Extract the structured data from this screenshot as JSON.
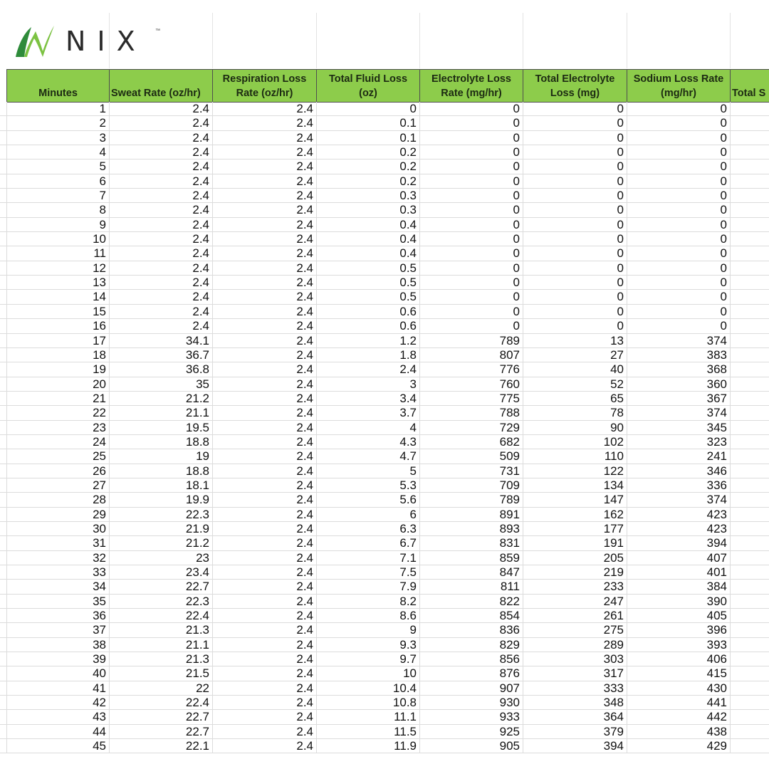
{
  "logo": {
    "text": "NIX",
    "tm": "™"
  },
  "headers": [
    "Minutes",
    "Sweat Rate (oz/hr)",
    "Respiration Loss\nRate (oz/hr)",
    "Total Fluid Loss\n(oz)",
    "Electrolyte Loss\nRate (mg/hr)",
    "Total Electrolyte\nLoss (mg)",
    "Sodium Loss Rate\n(mg/hr)",
    "Total S"
  ],
  "rows": [
    [
      "1",
      "2.4",
      "2.4",
      "0",
      "0",
      "0",
      "0"
    ],
    [
      "2",
      "2.4",
      "2.4",
      "0.1",
      "0",
      "0",
      "0"
    ],
    [
      "3",
      "2.4",
      "2.4",
      "0.1",
      "0",
      "0",
      "0"
    ],
    [
      "4",
      "2.4",
      "2.4",
      "0.2",
      "0",
      "0",
      "0"
    ],
    [
      "5",
      "2.4",
      "2.4",
      "0.2",
      "0",
      "0",
      "0"
    ],
    [
      "6",
      "2.4",
      "2.4",
      "0.2",
      "0",
      "0",
      "0"
    ],
    [
      "7",
      "2.4",
      "2.4",
      "0.3",
      "0",
      "0",
      "0"
    ],
    [
      "8",
      "2.4",
      "2.4",
      "0.3",
      "0",
      "0",
      "0"
    ],
    [
      "9",
      "2.4",
      "2.4",
      "0.4",
      "0",
      "0",
      "0"
    ],
    [
      "10",
      "2.4",
      "2.4",
      "0.4",
      "0",
      "0",
      "0"
    ],
    [
      "11",
      "2.4",
      "2.4",
      "0.4",
      "0",
      "0",
      "0"
    ],
    [
      "12",
      "2.4",
      "2.4",
      "0.5",
      "0",
      "0",
      "0"
    ],
    [
      "13",
      "2.4",
      "2.4",
      "0.5",
      "0",
      "0",
      "0"
    ],
    [
      "14",
      "2.4",
      "2.4",
      "0.5",
      "0",
      "0",
      "0"
    ],
    [
      "15",
      "2.4",
      "2.4",
      "0.6",
      "0",
      "0",
      "0"
    ],
    [
      "16",
      "2.4",
      "2.4",
      "0.6",
      "0",
      "0",
      "0"
    ],
    [
      "17",
      "34.1",
      "2.4",
      "1.2",
      "789",
      "13",
      "374"
    ],
    [
      "18",
      "36.7",
      "2.4",
      "1.8",
      "807",
      "27",
      "383"
    ],
    [
      "19",
      "36.8",
      "2.4",
      "2.4",
      "776",
      "40",
      "368"
    ],
    [
      "20",
      "35",
      "2.4",
      "3",
      "760",
      "52",
      "360"
    ],
    [
      "21",
      "21.2",
      "2.4",
      "3.4",
      "775",
      "65",
      "367"
    ],
    [
      "22",
      "21.1",
      "2.4",
      "3.7",
      "788",
      "78",
      "374"
    ],
    [
      "23",
      "19.5",
      "2.4",
      "4",
      "729",
      "90",
      "345"
    ],
    [
      "24",
      "18.8",
      "2.4",
      "4.3",
      "682",
      "102",
      "323"
    ],
    [
      "25",
      "19",
      "2.4",
      "4.7",
      "509",
      "110",
      "241"
    ],
    [
      "26",
      "18.8",
      "2.4",
      "5",
      "731",
      "122",
      "346"
    ],
    [
      "27",
      "18.1",
      "2.4",
      "5.3",
      "709",
      "134",
      "336"
    ],
    [
      "28",
      "19.9",
      "2.4",
      "5.6",
      "789",
      "147",
      "374"
    ],
    [
      "29",
      "22.3",
      "2.4",
      "6",
      "891",
      "162",
      "423"
    ],
    [
      "30",
      "21.9",
      "2.4",
      "6.3",
      "893",
      "177",
      "423"
    ],
    [
      "31",
      "21.2",
      "2.4",
      "6.7",
      "831",
      "191",
      "394"
    ],
    [
      "32",
      "23",
      "2.4",
      "7.1",
      "859",
      "205",
      "407"
    ],
    [
      "33",
      "23.4",
      "2.4",
      "7.5",
      "847",
      "219",
      "401"
    ],
    [
      "34",
      "22.7",
      "2.4",
      "7.9",
      "811",
      "233",
      "384"
    ],
    [
      "35",
      "22.3",
      "2.4",
      "8.2",
      "822",
      "247",
      "390"
    ],
    [
      "36",
      "22.4",
      "2.4",
      "8.6",
      "854",
      "261",
      "405"
    ],
    [
      "37",
      "21.3",
      "2.4",
      "9",
      "836",
      "275",
      "396"
    ],
    [
      "38",
      "21.1",
      "2.4",
      "9.3",
      "829",
      "289",
      "393"
    ],
    [
      "39",
      "21.3",
      "2.4",
      "9.7",
      "856",
      "303",
      "406"
    ],
    [
      "40",
      "21.5",
      "2.4",
      "10",
      "876",
      "317",
      "415"
    ],
    [
      "41",
      "22",
      "2.4",
      "10.4",
      "907",
      "333",
      "430"
    ],
    [
      "42",
      "22.4",
      "2.4",
      "10.8",
      "930",
      "348",
      "441"
    ],
    [
      "43",
      "22.7",
      "2.4",
      "11.1",
      "933",
      "364",
      "442"
    ],
    [
      "44",
      "22.7",
      "2.4",
      "11.5",
      "925",
      "379",
      "438"
    ],
    [
      "45",
      "22.1",
      "2.4",
      "11.9",
      "905",
      "394",
      "429"
    ]
  ],
  "colors": {
    "header_bg": "#8dcc4b",
    "logo_green": "#7cc242",
    "logo_dark": "#2e8b3a"
  }
}
